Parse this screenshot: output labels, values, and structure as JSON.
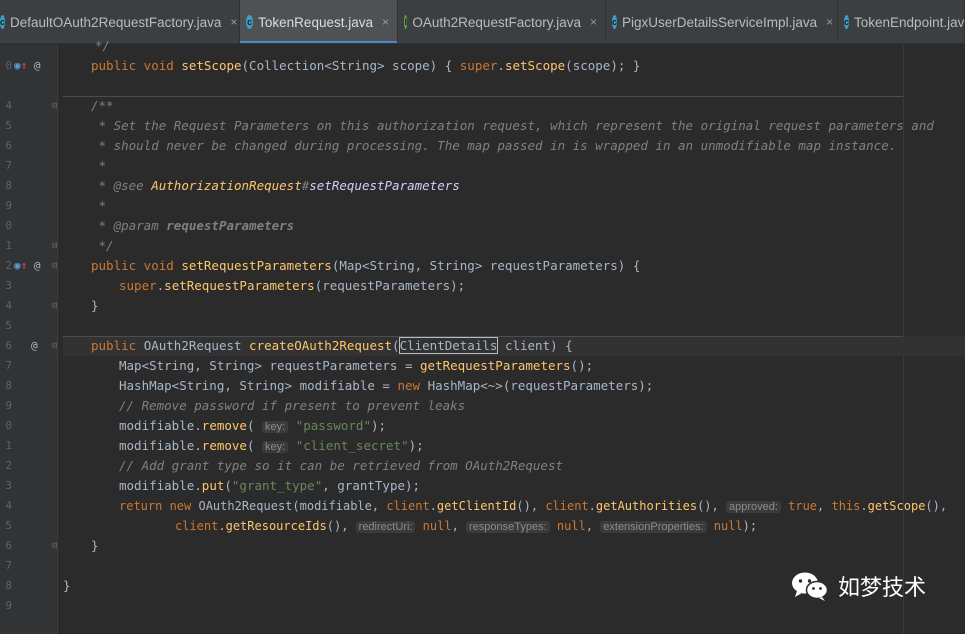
{
  "tabs": [
    {
      "label": "DefaultOAuth2RequestFactory.java",
      "icon": "class-icon",
      "active": false
    },
    {
      "label": "TokenRequest.java",
      "icon": "class-icon",
      "active": true
    },
    {
      "label": "OAuth2RequestFactory.java",
      "icon": "interface-icon",
      "active": false
    },
    {
      "label": "PigxUserDetailsServiceImpl.java",
      "icon": "class-icon",
      "active": false
    },
    {
      "label": "TokenEndpoint.java",
      "icon": "class-icon",
      "active": false
    }
  ],
  "tab_icon_letters": {
    "class": "c",
    "interface": "I"
  },
  "tab_close_glyph": "×",
  "line_numbers": [
    "",
    "0",
    "",
    "4",
    "5",
    "6",
    "7",
    "8",
    "9",
    "0",
    "1",
    "2",
    "3",
    "4",
    "5",
    "6",
    "7",
    "8",
    "9",
    "0",
    "1",
    "2",
    "3",
    "4",
    "5",
    "6",
    "7",
    "8",
    "9"
  ],
  "code": {
    "l0": "*/",
    "l1_kw": "public void ",
    "l1_m": "setScope",
    "l1_a": "(Collection<String> scope) { ",
    "l1_kw2": "super",
    "l1_b": ".",
    "l1_m2": "setScope",
    "l1_c": "(scope); }",
    "l3": "/**",
    "l4": " * Set the Request Parameters on this authorization request, which represent the original request parameters and",
    "l5": " * should never be changed during processing. The map passed in is wrapped in an unmodifiable map instance.",
    "l6": " *",
    "l7_a": " * ",
    "l7_tag": "@see",
    "l7_b": " ",
    "l7_ref1": "AuthorizationRequest",
    "l7_hash": "#",
    "l7_ref2": "setRequestParameters",
    "l8": " *",
    "l9_a": " * ",
    "l9_tag": "@param",
    "l9_b": " ",
    "l9_name": "requestParameters",
    "l10": " */",
    "l11_kw": "public void ",
    "l11_m": "setRequestParameters",
    "l11_a": "(Map<String, String> requestParameters) {",
    "l12_kw": "super",
    "l12_a": ".",
    "l12_m": "setRequestParameters",
    "l12_b": "(requestParameters);",
    "l13": "}",
    "l15_kw": "public ",
    "l15_t": "OAuth2Request ",
    "l15_m": "createOAuth2Request",
    "l15_p": "(",
    "l15_box": "ClientDetails",
    "l15_a": " client) {",
    "l16_a": "Map<String, String> requestParameters = ",
    "l16_m": "getRequestParameters",
    "l16_b": "();",
    "l17_a": "HashMap<String, String> modifiable = ",
    "l17_kw": "new ",
    "l17_b": "HashMap<~>(requestParameters);",
    "l18": "// Remove password if present to prevent leaks",
    "l19_a": "modifiable.",
    "l19_m": "remove",
    "l19_b": "( ",
    "l19_hint": "key:",
    "l19_s": " \"password\"",
    "l19_c": ");",
    "l20_a": "modifiable.",
    "l20_m": "remove",
    "l20_b": "( ",
    "l20_hint": "key:",
    "l20_s": " \"client_secret\"",
    "l20_c": ");",
    "l21": "// Add grant type so it can be retrieved from OAuth2Request",
    "l22_a": "modifiable.",
    "l22_m": "put",
    "l22_b": "(",
    "l22_s": "\"grant_type\"",
    "l22_c": ", grantType);",
    "l23_kw": "return new ",
    "l23_a": "OAuth2Request(modifiable, ",
    "l23_f1": "client",
    "l23_b": ".",
    "l23_m1": "getClientId",
    "l23_c": "(), ",
    "l23_f2": "client",
    "l23_d": ".",
    "l23_m2": "getAuthorities",
    "l23_e": "(), ",
    "l23_hint": "approved:",
    "l23_v": " true",
    "l23_f": ", ",
    "l23_kw2": "this",
    "l23_g": ".",
    "l23_m3": "getScope",
    "l23_h": "(),",
    "l24_f": "client",
    "l24_a": ".",
    "l24_m": "getResourceIds",
    "l24_b": "(), ",
    "l24_h1": "redirectUri:",
    "l24_v1": " null",
    "l24_c": ", ",
    "l24_h2": "responseTypes:",
    "l24_v2": " null",
    "l24_d": ", ",
    "l24_h3": "extensionProperties:",
    "l24_v3": " null",
    "l24_e": ");",
    "l25": "}",
    "l27": "}"
  },
  "gutter_glyphs": {
    "override": "◉",
    "up": "↑",
    "annotation": "@",
    "fold": "⊟"
  },
  "watermark": {
    "icon": "wechat-icon",
    "text": "如梦技术"
  }
}
